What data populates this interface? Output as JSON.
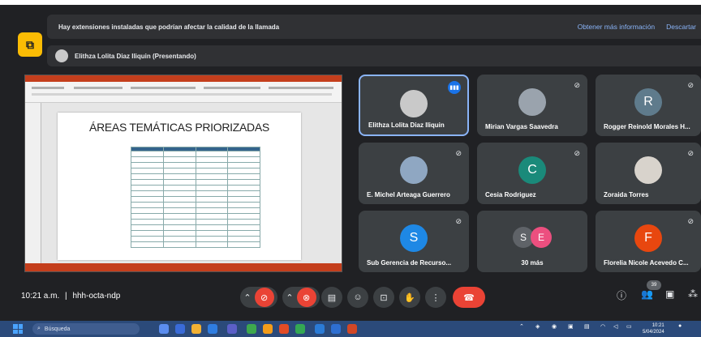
{
  "banner": {
    "warning": "Hay extensiones instaladas que podrían afectar la calidad de la llamada",
    "learn_more": "Obtener más información",
    "dismiss": "Descartar",
    "presenter": "Elithza Lolita Diaz Iliquin (Presentando)"
  },
  "slide": {
    "title": "ÁREAS TEMÁTICAS PRIORIZADAS"
  },
  "participants": [
    {
      "name": "Elithza Lolita Diaz Iliquin",
      "initial": "",
      "color": "#c9c9c9"
    },
    {
      "name": "Mirian Vargas Saavedra",
      "initial": "",
      "color": "#9aa3ad"
    },
    {
      "name": "Rogger Reinold Morales H...",
      "initial": "R",
      "color": "#5f7b8c"
    },
    {
      "name": "E. Michel Arteaga Guerrero",
      "initial": "",
      "color": "#8fa7c2"
    },
    {
      "name": "Cesia Rodriguez",
      "initial": "C",
      "color": "#1a8a7a"
    },
    {
      "name": "Zoraida Torres",
      "initial": "",
      "color": "#d8d3cc"
    },
    {
      "name": "Sub Gerencia de Recurso...",
      "initial": "S",
      "color": "#1e88e5"
    },
    {
      "name": "30 más",
      "initial": "",
      "color": "#3c4043"
    },
    {
      "name": "Florelia Nicole Acevedo C...",
      "initial": "F",
      "color": "#e8470f"
    }
  ],
  "more_avatars": [
    {
      "initial": "S",
      "color": "#5f6368"
    },
    {
      "initial": "E",
      "color": "#ec4f7f"
    }
  ],
  "bottom": {
    "time": "10:21 a.m.",
    "separator": "|",
    "meeting_code": "hhh-octa-ndp",
    "people_count": "39"
  },
  "taskbar": {
    "search_placeholder": "Búsqueda",
    "clock_time": "10:21",
    "clock_date": "5/04/2024"
  },
  "icons": {
    "extension": "puzzle-icon",
    "mic_muted": "mic-off-icon",
    "speaking": "audio-wave-icon"
  }
}
